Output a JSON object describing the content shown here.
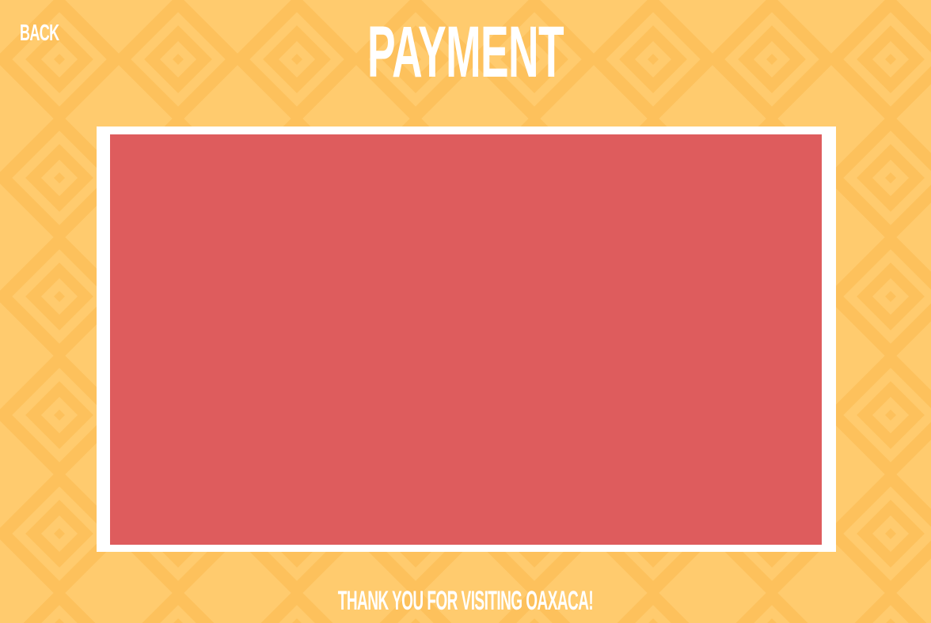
{
  "header": {
    "back_label": "BACK",
    "title": "PAYMENT"
  },
  "footer": {
    "message": "THANK YOU FOR VISITING OAXACA!"
  },
  "colors": {
    "background": "#ffcb6e",
    "pattern": "#fdc15c",
    "panel_frame": "#ffffff",
    "panel": "#de5c5d",
    "text": "#ffffff"
  }
}
